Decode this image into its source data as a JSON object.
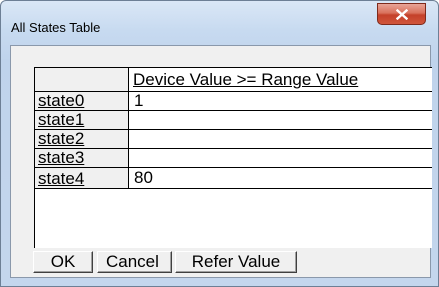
{
  "window": {
    "title": "All States Table"
  },
  "table": {
    "column_header": "Device Value >= Range Value",
    "rows": [
      {
        "label": "state0",
        "value": "1"
      },
      {
        "label": "state1",
        "value": ""
      },
      {
        "label": "state2",
        "value": ""
      },
      {
        "label": "state3",
        "value": ""
      },
      {
        "label": "state4",
        "value": "80"
      }
    ]
  },
  "buttons": {
    "ok_label": "OK",
    "cancel_label": "Cancel",
    "refer_label": "Refer Value"
  },
  "icons": {
    "close": "close-icon"
  },
  "colors": {
    "close_button": "#c4412a",
    "title_gradient": "#c7daf0",
    "client_bg": "#f0f0f0"
  }
}
